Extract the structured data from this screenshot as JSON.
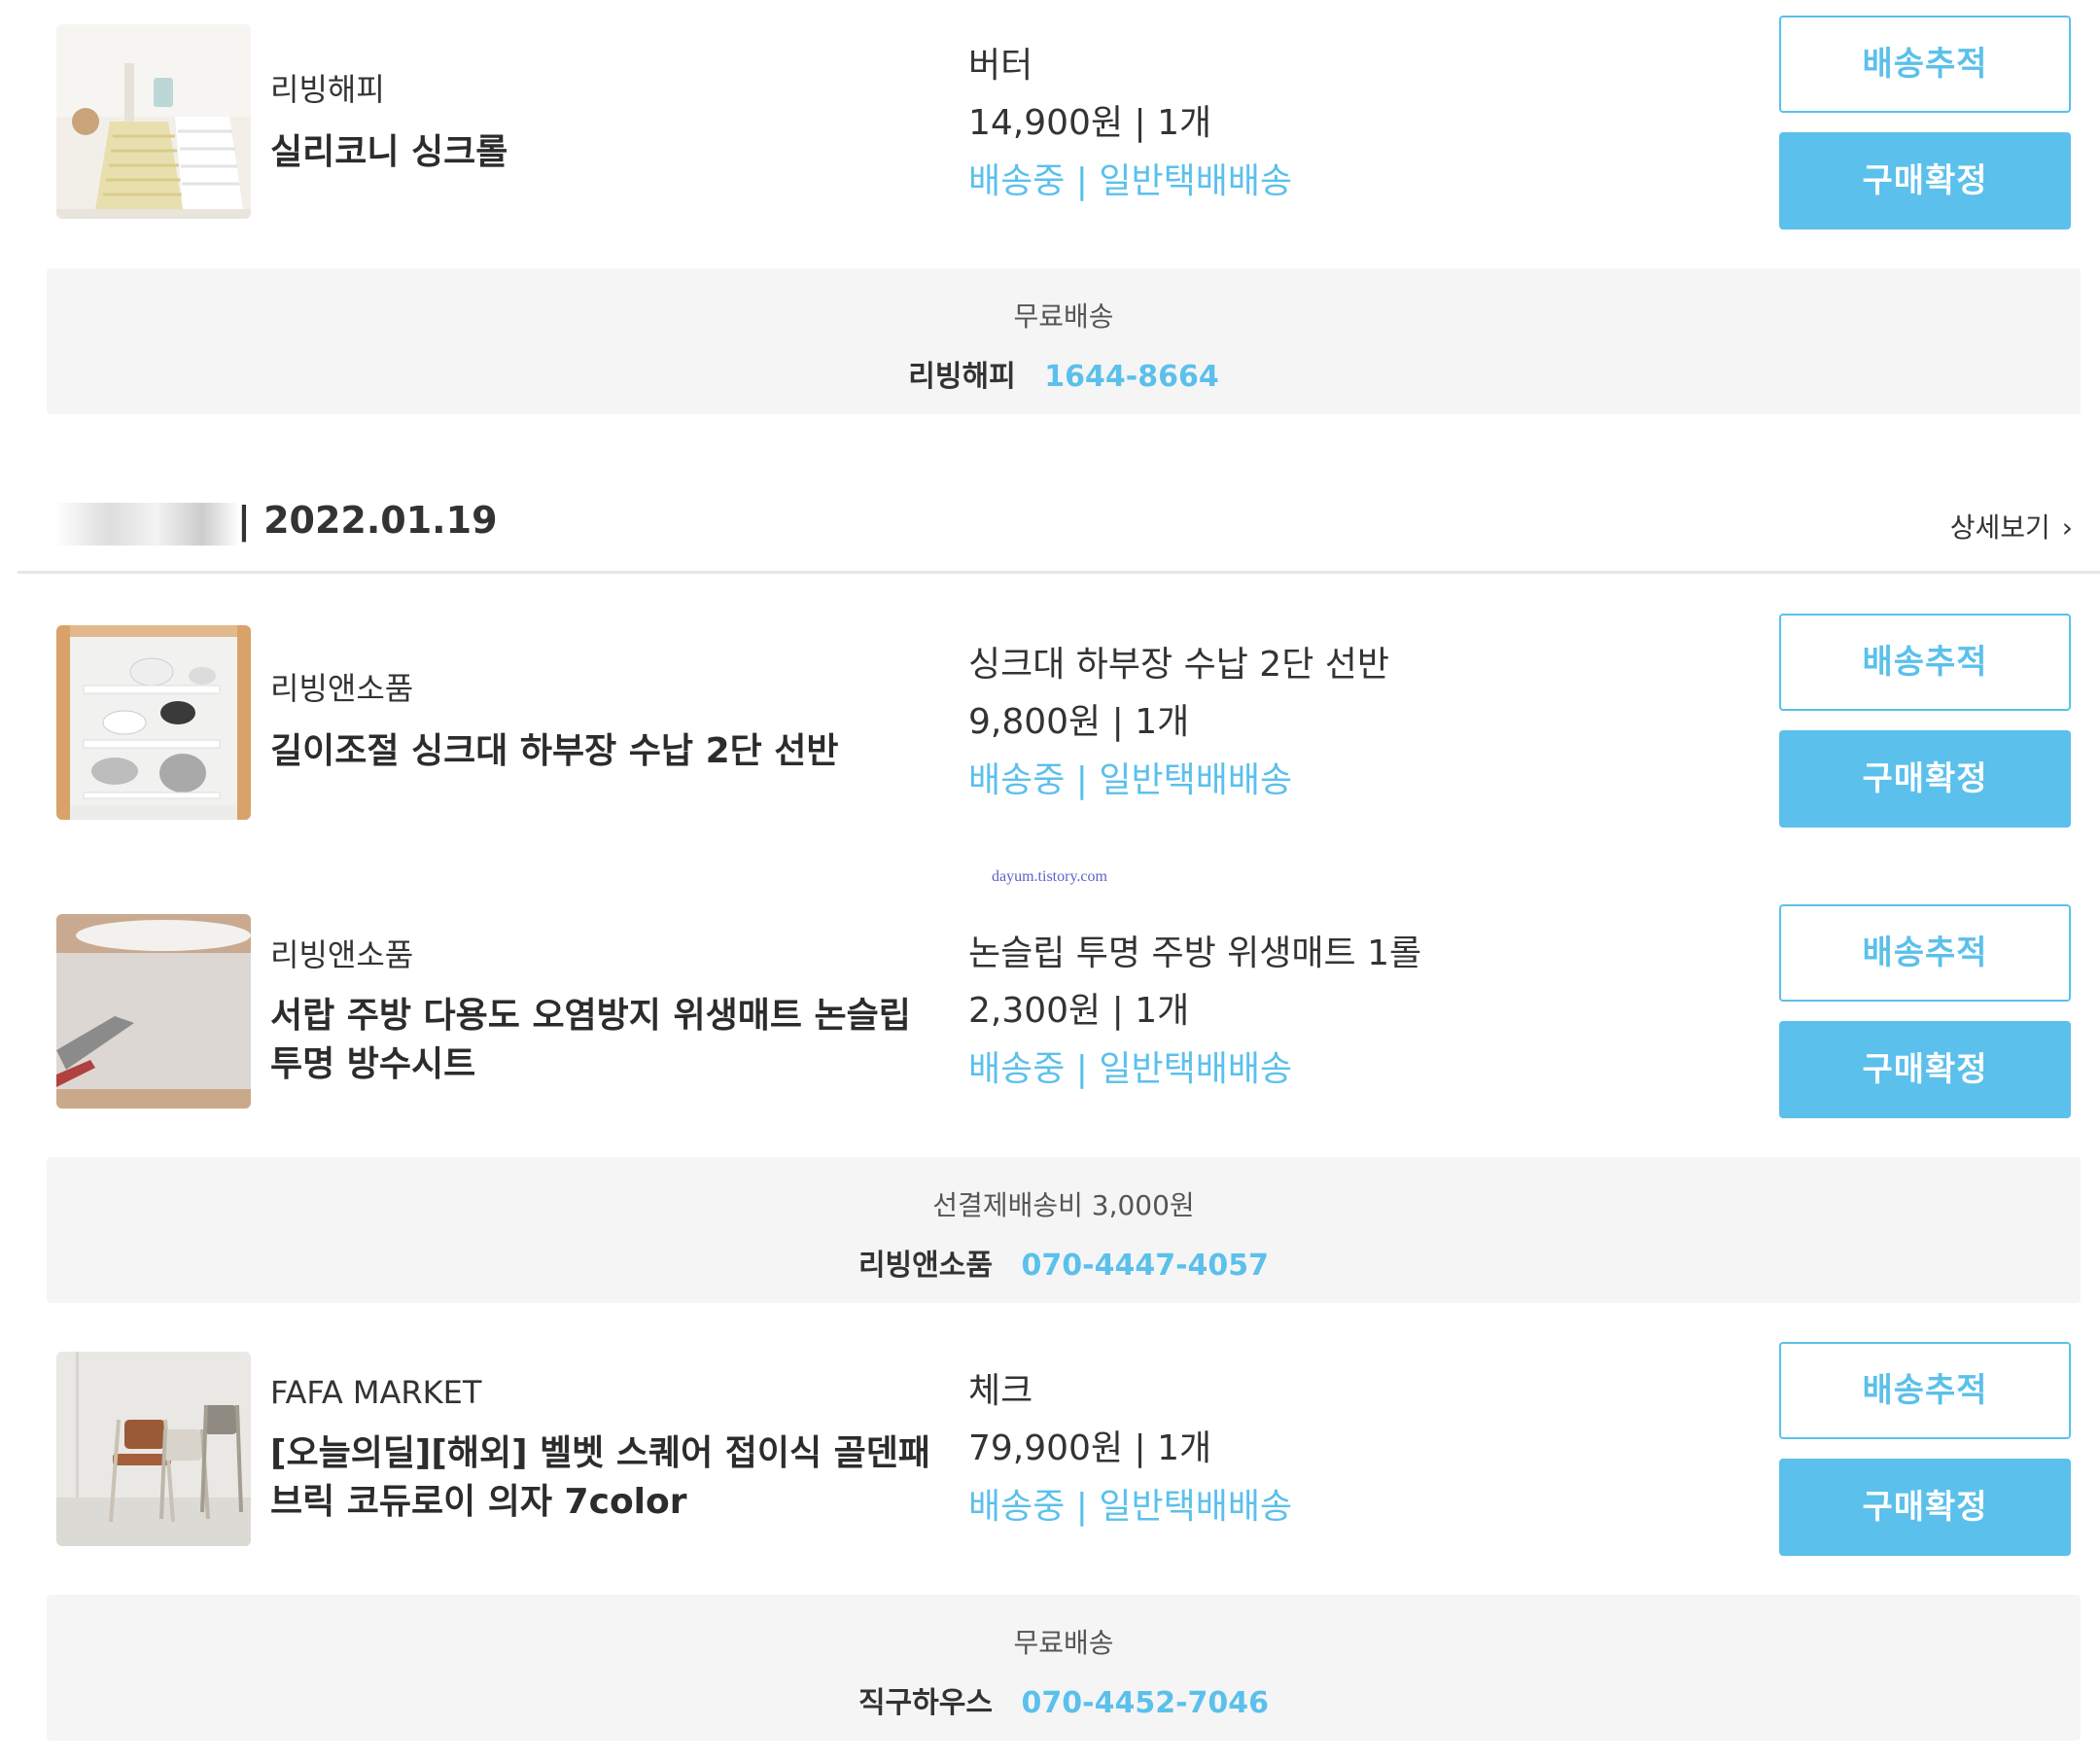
{
  "buttons": {
    "track": "배송추적",
    "confirm": "구매확정"
  },
  "items": [
    {
      "seller": "리빙해피",
      "name": "실리코니 싱크롤",
      "option": "버터",
      "price_qty": "14,900원 | 1개",
      "status": "배송중 | 일반택배배송",
      "image_icon": "sink-roll-photo"
    },
    {
      "seller": "리빙앤소품",
      "name": "길이조절 싱크대 하부장 수납 2단 선반",
      "option": "싱크대 하부장 수납 2단 선반",
      "price_qty": "9,800원 | 1개",
      "status": "배송중 | 일반택배배송",
      "image_icon": "shelf-photo"
    },
    {
      "seller": "리빙앤소품",
      "name": "서랍 주방 다용도 오염방지 위생매트 논슬립 투명 방수시트",
      "option": "논슬립 투명 주방 위생매트 1롤",
      "price_qty": "2,300원 | 1개",
      "status": "배송중 | 일반택배배송",
      "image_icon": "mat-photo"
    },
    {
      "seller": "FAFA MARKET",
      "name": "[오늘의딜][해외] 벨벳 스퀘어 접이식 골덴패브릭 코듀로이 의자 7color",
      "option": "체크",
      "price_qty": "79,900원 | 1개",
      "status": "배송중 | 일반택배배송",
      "image_icon": "chair-photo"
    }
  ],
  "shipping": [
    {
      "fee": "무료배송",
      "company": "리빙해피",
      "phone": "1644-8664"
    },
    {
      "fee": "선결제배송비 3,000원",
      "company": "리빙앤소품",
      "phone": "070-4447-4057"
    },
    {
      "fee": "무료배송",
      "company": "직구하우스",
      "phone": "070-4452-7046"
    }
  ],
  "order": {
    "date": "| 2022.01.19",
    "detail_label": "상세보기",
    "detail_icon": "chevron-right-icon"
  },
  "watermark": "dayum.tistory.com",
  "colors": {
    "accent": "#5bc0eb",
    "box_bg": "#f5f5f5",
    "text": "#333333"
  }
}
